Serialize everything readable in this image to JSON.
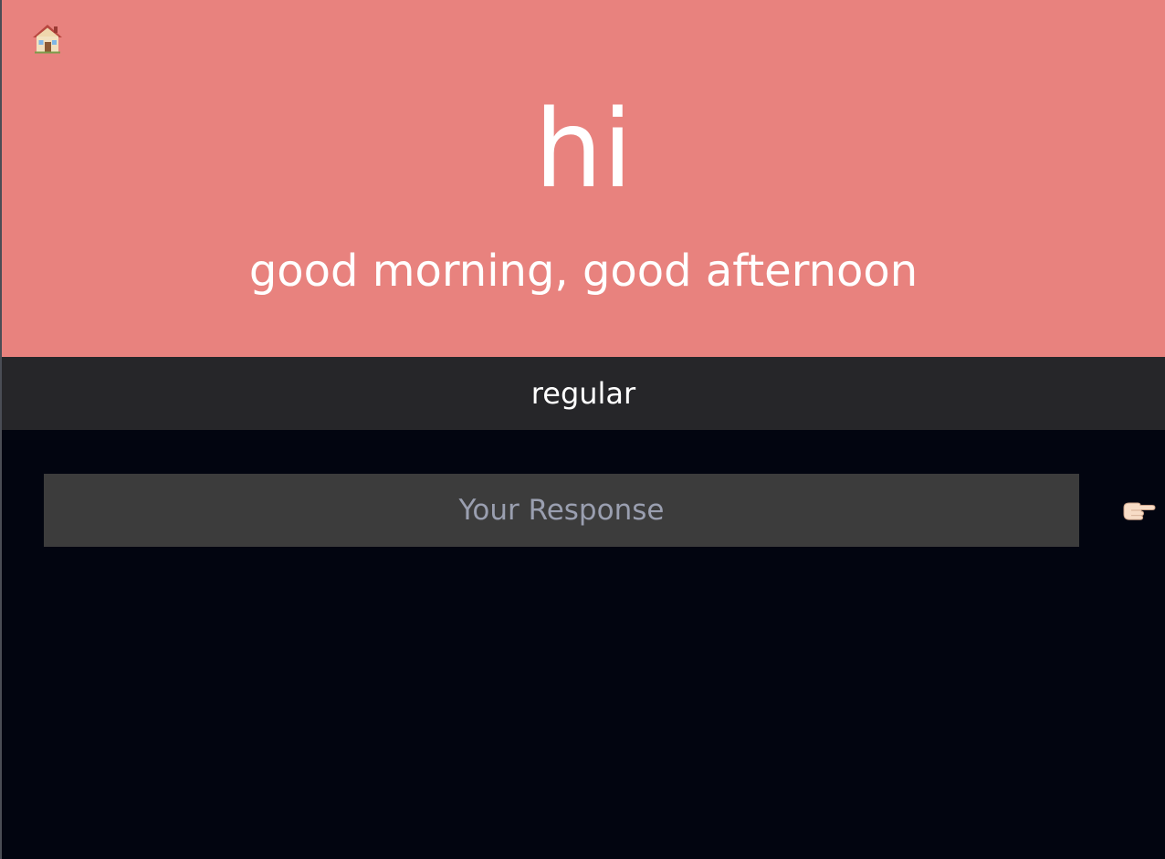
{
  "home": {
    "icon": "house-icon"
  },
  "card": {
    "word": "hi",
    "meaning": "good morning, good afternoon",
    "type_label": "regular"
  },
  "response": {
    "placeholder": "Your Response",
    "value": ""
  },
  "submit": {
    "icon": "pointing-hand-icon"
  },
  "colors": {
    "hero_background": "#e8827e",
    "type_bar_background": "#262629",
    "page_background": "#020510",
    "input_background": "#3c3c3c",
    "placeholder": "#9a9fb0"
  }
}
